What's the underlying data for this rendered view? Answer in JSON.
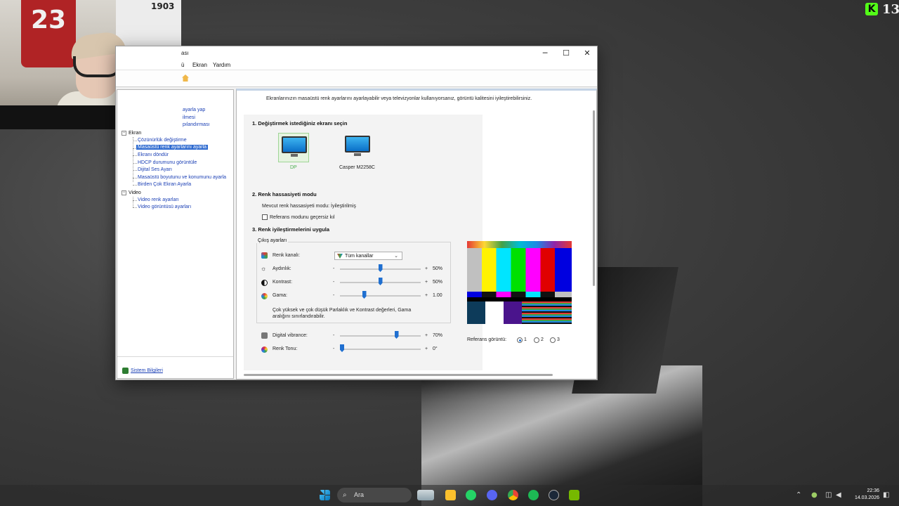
{
  "window": {
    "title": "ası",
    "controls": {
      "minimize": "─",
      "maximize": "☐",
      "close": "✕"
    },
    "menu": [
      "ü",
      "Ekran",
      "Yardım"
    ]
  },
  "sidebar": {
    "top_items": [
      "ayarla yap",
      "ilmesi",
      "pılandırması"
    ],
    "ekran_node": "Ekran",
    "ekran_items": [
      "Çözünürlük değiştirme",
      "Masaüstü renk ayarlarını ayarla",
      "Ekranı döndür",
      "HDCP durumunu görüntüle",
      "Dijital Ses Ayarı",
      "Masaüstü boyutunu ve konumunu ayarla",
      "Birden Çok Ekran Ayarla"
    ],
    "selected_index": 1,
    "video_node": "Video",
    "video_items": [
      "Video renk ayarları",
      "Video görüntüsü ayarları"
    ],
    "system_info": "Sistem Bilgileri",
    "toggle_expanded": "−"
  },
  "content": {
    "intro": "Ekranlarınızın masaüstü renk ayarlarını ayarlayabilir veya televizyonlar kullanıyorsanız, görüntü kalitesini iyileştirebilirsiniz.",
    "section1": "1. Değiştirmek istediğiniz ekranı seçin",
    "monitors": [
      {
        "label": "DP",
        "selected": true
      },
      {
        "label": "Casper M2258C",
        "selected": false
      }
    ],
    "section2": "2. Renk hassasiyeti modu",
    "current_mode": "Mevcut renk hassasiyeti modu: İyileştirilmiş",
    "override_checkbox": "Referans modunu geçersiz kıl",
    "section3": "3. Renk iyileştirmelerini uygula",
    "output_group": "Çıkış ayarları",
    "channel_label": "Renk kanalı:",
    "channel_value": "Tüm kanallar",
    "sliders": [
      {
        "label": "Aydınlık:",
        "value": "50%",
        "level": 0.5,
        "icon": "sun-icon"
      },
      {
        "label": "Kontrast:",
        "value": "50%",
        "level": 0.5,
        "icon": "contrast-icon"
      },
      {
        "label": "Gama:",
        "value": "1.00",
        "level": 0.3,
        "icon": "gamma-icon"
      }
    ],
    "warning": "Çok yüksek ve çok düşük Parlaklık ve Kontrast değerleri, Gama aralığını sınırlandırabilir.",
    "vibrance": {
      "label": "Digital vibrance:",
      "value": "70%",
      "level": 0.7
    },
    "hue": {
      "label": "Renk Tonu:",
      "value": "0°",
      "level": 0.0
    },
    "minus": "-",
    "plus": "+",
    "reference_label": "Referans görüntü:",
    "reference_options": [
      "1",
      "2",
      "3"
    ],
    "reference_selected": 0
  },
  "taskbar": {
    "search_label": "Ara",
    "time": "22:36",
    "date": "14.03.2026",
    "icons": [
      "windows-start-icon",
      "weather-icon",
      "file-explorer-icon",
      "whatsapp-icon",
      "discord-icon",
      "chrome-icon",
      "spotify-icon",
      "steam-icon",
      "nvidia-icon"
    ]
  },
  "overlay": {
    "kick_logo": "K",
    "kick_count": "13",
    "jersey_number": "23",
    "jersey_text": "1903"
  },
  "colors": {
    "accent": "#1f6fd0",
    "selection": "#2f6bd0",
    "link": "#1a3fb5",
    "kick_green": "#53fc18"
  }
}
